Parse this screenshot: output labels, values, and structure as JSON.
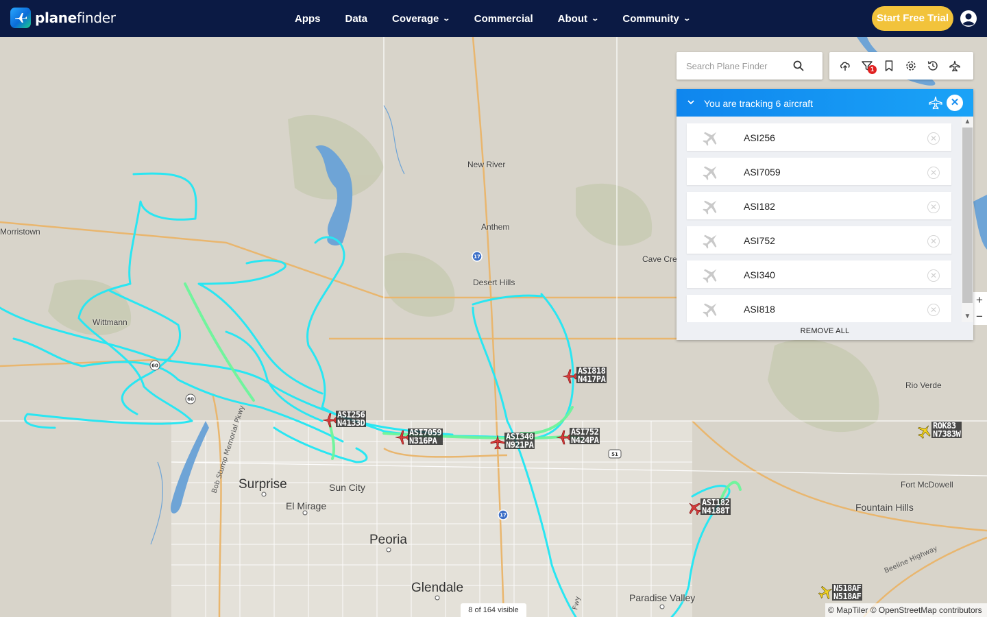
{
  "brand": {
    "name_bold": "plane",
    "name_rest": "finder"
  },
  "nav": {
    "items": [
      {
        "label": "Apps",
        "has_dropdown": false
      },
      {
        "label": "Data",
        "has_dropdown": false
      },
      {
        "label": "Coverage",
        "has_dropdown": true
      },
      {
        "label": "Commercial",
        "has_dropdown": false
      },
      {
        "label": "About",
        "has_dropdown": true
      },
      {
        "label": "Community",
        "has_dropdown": true
      }
    ],
    "cta_label": "Start Free Trial"
  },
  "search": {
    "placeholder": "Search Plane Finder",
    "value": ""
  },
  "toolbar": {
    "icons": [
      "cloud-upload-icon",
      "filter-icon",
      "bookmark-icon",
      "settings-icon",
      "history-icon",
      "3d-view-icon"
    ],
    "filter_badge": "1"
  },
  "tracking": {
    "title": "You are tracking 6 aircraft",
    "items": [
      {
        "callsign": "ASI256"
      },
      {
        "callsign": "ASI7059"
      },
      {
        "callsign": "ASI182"
      },
      {
        "callsign": "ASI752"
      },
      {
        "callsign": "ASI340"
      },
      {
        "callsign": "ASI818"
      }
    ],
    "remove_all_label": "REMOVE ALL"
  },
  "map": {
    "places": [
      {
        "name": "Morristown",
        "size": "small"
      },
      {
        "name": "New River",
        "size": "small"
      },
      {
        "name": "Anthem",
        "size": "small"
      },
      {
        "name": "Desert Hills",
        "size": "small"
      },
      {
        "name": "Cave Creek",
        "size": "small"
      },
      {
        "name": "Wittmann",
        "size": "small"
      },
      {
        "name": "Rio Verde",
        "size": "small"
      },
      {
        "name": "Fort McDowell",
        "size": "small"
      },
      {
        "name": "Fountain Hills",
        "size": "mid"
      },
      {
        "name": "Surprise",
        "size": "big"
      },
      {
        "name": "Sun City",
        "size": "mid"
      },
      {
        "name": "El Mirage",
        "size": "mid"
      },
      {
        "name": "Peoria",
        "size": "big"
      },
      {
        "name": "Glendale",
        "size": "big"
      },
      {
        "name": "Paradise Valley",
        "size": "mid"
      }
    ],
    "road_labels": [
      "Bob Stump Memorial Pkwy",
      "Beeline Highway",
      "Fwy"
    ],
    "shields": [
      "17",
      "17",
      "60",
      "60",
      "51"
    ],
    "aircraft": [
      {
        "callsign": "ASI818",
        "reg": "N417PA",
        "tracked": true
      },
      {
        "callsign": "ASI256",
        "reg": "N4133D",
        "tracked": true
      },
      {
        "callsign": "ASI7059",
        "reg": "N316PA",
        "tracked": true
      },
      {
        "callsign": "ASI340",
        "reg": "N921PA",
        "tracked": true
      },
      {
        "callsign": "ASI752",
        "reg": "N424PA",
        "tracked": true
      },
      {
        "callsign": "ASI182",
        "reg": "N4188T",
        "tracked": true
      },
      {
        "callsign": "ROK83",
        "reg": "N7383W",
        "tracked": false
      },
      {
        "callsign": "N518AF",
        "reg": "N518AF",
        "tracked": false
      }
    ],
    "visible_count": "8 of 164 visible",
    "attribution": "© MapTiler © OpenStreetMap contributors",
    "zoom_in": "+",
    "zoom_out": "−"
  },
  "colors": {
    "nav_bg": "#0b1a44",
    "cta": "#f2c33b",
    "track_line": "#29e6f2",
    "track_line_alt": "#6cf59a",
    "panel_header": "#1aa3f7",
    "tracked_plane": "#d63a3a",
    "other_plane": "#f2d21f",
    "water": "#6ea4d6"
  }
}
